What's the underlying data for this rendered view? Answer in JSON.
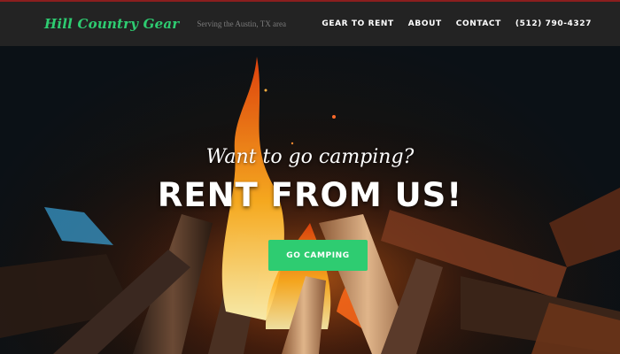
{
  "navbar": {
    "brand": "Hill Country Gear",
    "tagline": "Serving the Austin, TX area",
    "links": [
      "GEAR TO RENT",
      "ABOUT",
      "CONTACT",
      "(512) 790-4327"
    ]
  },
  "hero": {
    "subtitle": "Want to go camping?",
    "title": "RENT FROM US!",
    "cta_label": "GO CAMPING"
  },
  "colors": {
    "accent": "#2ecc71",
    "navbar_bg": "#232323",
    "navbar_border": "#8b1e1e"
  }
}
